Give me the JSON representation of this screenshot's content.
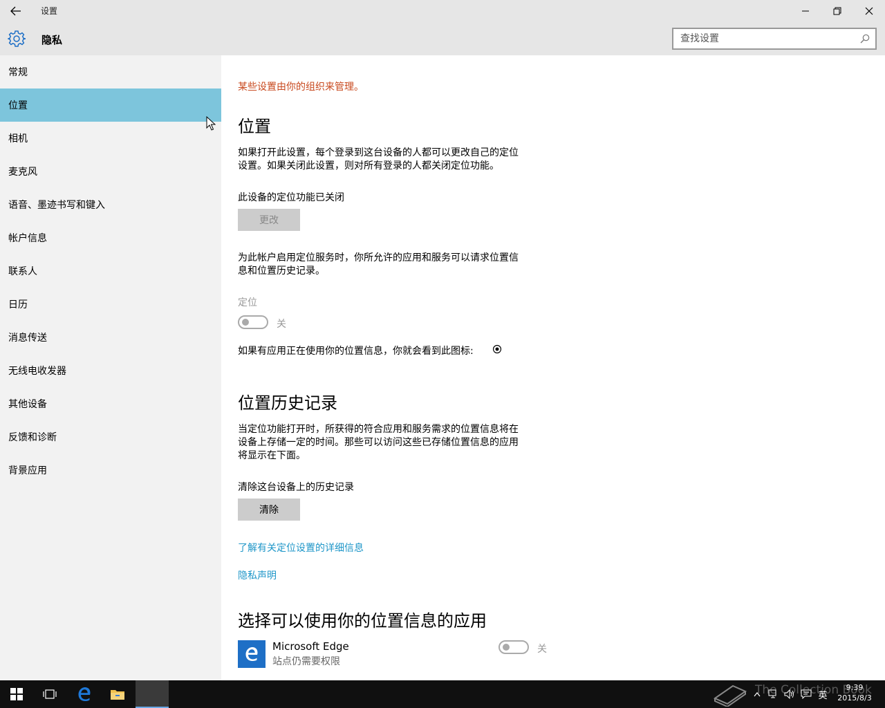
{
  "window": {
    "title": "设置",
    "section": "隐私"
  },
  "search": {
    "placeholder": "查找设置",
    "value": ""
  },
  "sidebar": {
    "items": [
      {
        "label": "常规",
        "active": false
      },
      {
        "label": "位置",
        "active": true
      },
      {
        "label": "相机",
        "active": false
      },
      {
        "label": "麦克风",
        "active": false
      },
      {
        "label": "语音、墨迹书写和键入",
        "active": false
      },
      {
        "label": "帐户信息",
        "active": false
      },
      {
        "label": "联系人",
        "active": false
      },
      {
        "label": "日历",
        "active": false
      },
      {
        "label": "消息传送",
        "active": false
      },
      {
        "label": "无线电收发器",
        "active": false
      },
      {
        "label": "其他设备",
        "active": false
      },
      {
        "label": "反馈和诊断",
        "active": false
      },
      {
        "label": "背景应用",
        "active": false
      }
    ]
  },
  "content": {
    "notice": "某些设置由你的组织来管理。",
    "location": {
      "heading": "位置",
      "description_line1": "如果打开此设置，每个登录到这台设备的人都可以更改自己的定位",
      "description_line2": "设置。如果关闭此设置，则对所有登录的人都关闭定位功能。",
      "device_status": "此设备的定位功能已关闭",
      "change_button": "更改",
      "account_desc_line1": "为此帐户启用定位服务时，你所允许的应用和服务可以请求位置信",
      "account_desc_line2": "息和位置历史记录。",
      "toggle_label": "定位",
      "toggle_state": "关",
      "icon_note": "如果有应用正在使用你的位置信息，你就会看到此图标:"
    },
    "history": {
      "heading": "位置历史记录",
      "desc_line1": "当定位功能打开时，所获得的符合应用和服务需求的位置信息将在",
      "desc_line2": "设备上存储一定的时间。那些可以访问这些已存储位置信息的应用",
      "desc_line3": "将显示在下面。",
      "clear_label": "清除这台设备上的历史记录",
      "clear_button": "清除"
    },
    "links": {
      "learn_more": "了解有关定位设置的详细信息",
      "privacy": "隐私声明"
    },
    "apps": {
      "heading": "选择可以使用你的位置信息的应用",
      "items": [
        {
          "name": "Microsoft Edge",
          "subtitle": "站点仍需要权限",
          "state": "关"
        }
      ]
    }
  },
  "taskbar": {
    "ime": "英",
    "time": "9:39",
    "date": "2015/8/3",
    "watermark": "The Collection Book"
  },
  "colors": {
    "accent_selected": "#7dc5dc",
    "notice": "#c8491e",
    "link": "#1e96c8",
    "edge_tile": "#1e6fc6"
  }
}
